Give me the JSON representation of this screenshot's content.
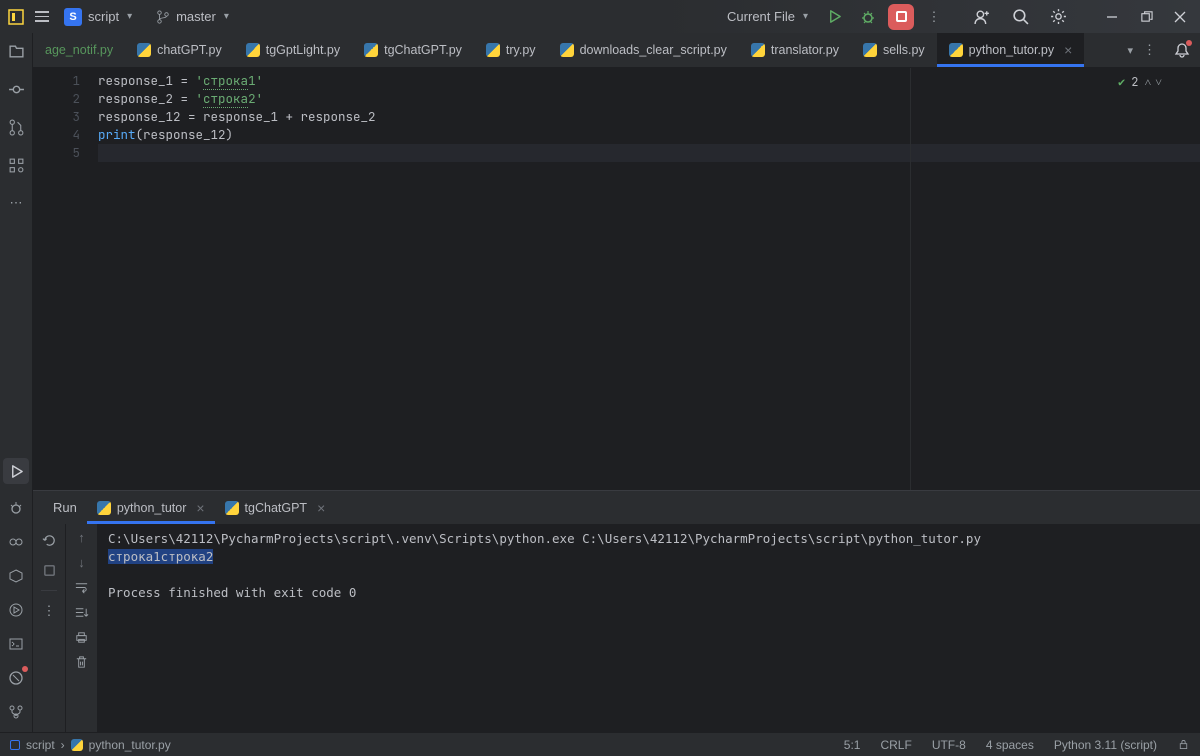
{
  "titlebar": {
    "project_initial": "S",
    "project_name": "script",
    "branch": "master",
    "run_config": "Current File"
  },
  "tabs": [
    {
      "label": "age_notif.py"
    },
    {
      "label": "chatGPT.py"
    },
    {
      "label": "tgGptLight.py"
    },
    {
      "label": "tgChatGPT.py"
    },
    {
      "label": "try.py"
    },
    {
      "label": "downloads_clear_script.py"
    },
    {
      "label": "translator.py"
    },
    {
      "label": "sells.py"
    },
    {
      "label": "python_tutor.py",
      "active": true
    }
  ],
  "inspection": {
    "count": "2"
  },
  "code": {
    "lines": [
      "1",
      "2",
      "3",
      "4",
      "5"
    ],
    "l1_var": "response_1",
    "l1_eq": " = ",
    "l1_q1": "'",
    "l1_str": "строка",
    "l1_num": "1",
    "l1_q2": "'",
    "l2_var": "response_2",
    "l2_eq": " = ",
    "l2_q1": "'",
    "l2_str": "строка",
    "l2_num": "2",
    "l2_q2": "'",
    "l3": "response_12 = response_1 + response_2",
    "l4_func": "print",
    "l4_args": "(response_12)"
  },
  "run": {
    "label": "Run",
    "tabs": [
      {
        "label": "python_tutor",
        "active": true
      },
      {
        "label": "tgChatGPT"
      }
    ],
    "cmd": "C:\\Users\\42112\\PycharmProjects\\script\\.venv\\Scripts\\python.exe C:\\Users\\42112\\PycharmProjects\\script\\python_tutor.py",
    "output": "строка1строка2",
    "exit": "Process finished with exit code 0"
  },
  "breadcrumb": {
    "root": "script",
    "file": "python_tutor.py"
  },
  "status": {
    "pos": "5:1",
    "sep": "CRLF",
    "enc": "UTF-8",
    "indent": "4 spaces",
    "interpreter": "Python 3.11 (script)"
  }
}
